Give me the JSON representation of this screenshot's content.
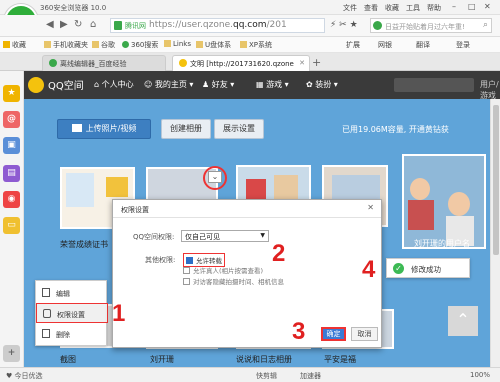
{
  "browser": {
    "title": "360安全浏览器 10.0",
    "menu": [
      "文件",
      "查看",
      "收藏",
      "工具",
      "帮助"
    ],
    "secure_label": "腾讯网",
    "url_host": "qq.com",
    "url_prefix": "https://user.qzone.",
    "url_suffix": "/201",
    "search_placeholder": "日益开始贴着月过六年重!",
    "bookmarks": [
      "收藏",
      "手机收藏夹",
      "谷歌",
      "360搜索",
      "Links",
      "U盘体系",
      "XP系统"
    ],
    "bookmark_right": [
      "扩展",
      "网银",
      "翻译",
      "登录"
    ]
  },
  "tabs": [
    {
      "label": "离线编辑器_百度经验",
      "active": false
    },
    {
      "label": "文明 [http://201731620.qzone",
      "active": true
    }
  ],
  "qzone": {
    "title": "QQ空间",
    "nav": [
      "个人中心",
      "我的主页",
      "好友",
      "游戏",
      "装扮"
    ],
    "user_area": "用户/游戏",
    "upload_button": "上传照片/视频",
    "create_album_button": "创建相册",
    "display_settings_button": "展示设置",
    "capacity_text": "已用19.06M容量, 开通黄钻获",
    "album_captions": [
      "荣誉成绩证书",
      "截图",
      "刘开珊",
      "说说和日志相册",
      "平安是福",
      "刘开珊的用户名"
    ]
  },
  "context_menu": {
    "items": [
      "编辑",
      "权限设置",
      "删除"
    ]
  },
  "dialog": {
    "title": "权限设置",
    "qq_permission_label": "QQ空间权限:",
    "qq_permission_value": "仅自己可见",
    "other_permission_label": "其他权限:",
    "options": [
      {
        "label": "允许转载",
        "checked": true
      },
      {
        "label": "允许真人(相片按需查看)",
        "checked": false
      },
      {
        "label": "对访客隐藏拍摄时间、相机信息",
        "checked": false
      }
    ],
    "ok_label": "确定",
    "cancel_label": "取消"
  },
  "toast": {
    "text": "修改成功"
  },
  "steps": [
    "1",
    "2",
    "3",
    "4"
  ],
  "status_bar": {
    "left": "今日优选",
    "items": [
      "快剪辑",
      "加速器",
      "100%"
    ]
  }
}
